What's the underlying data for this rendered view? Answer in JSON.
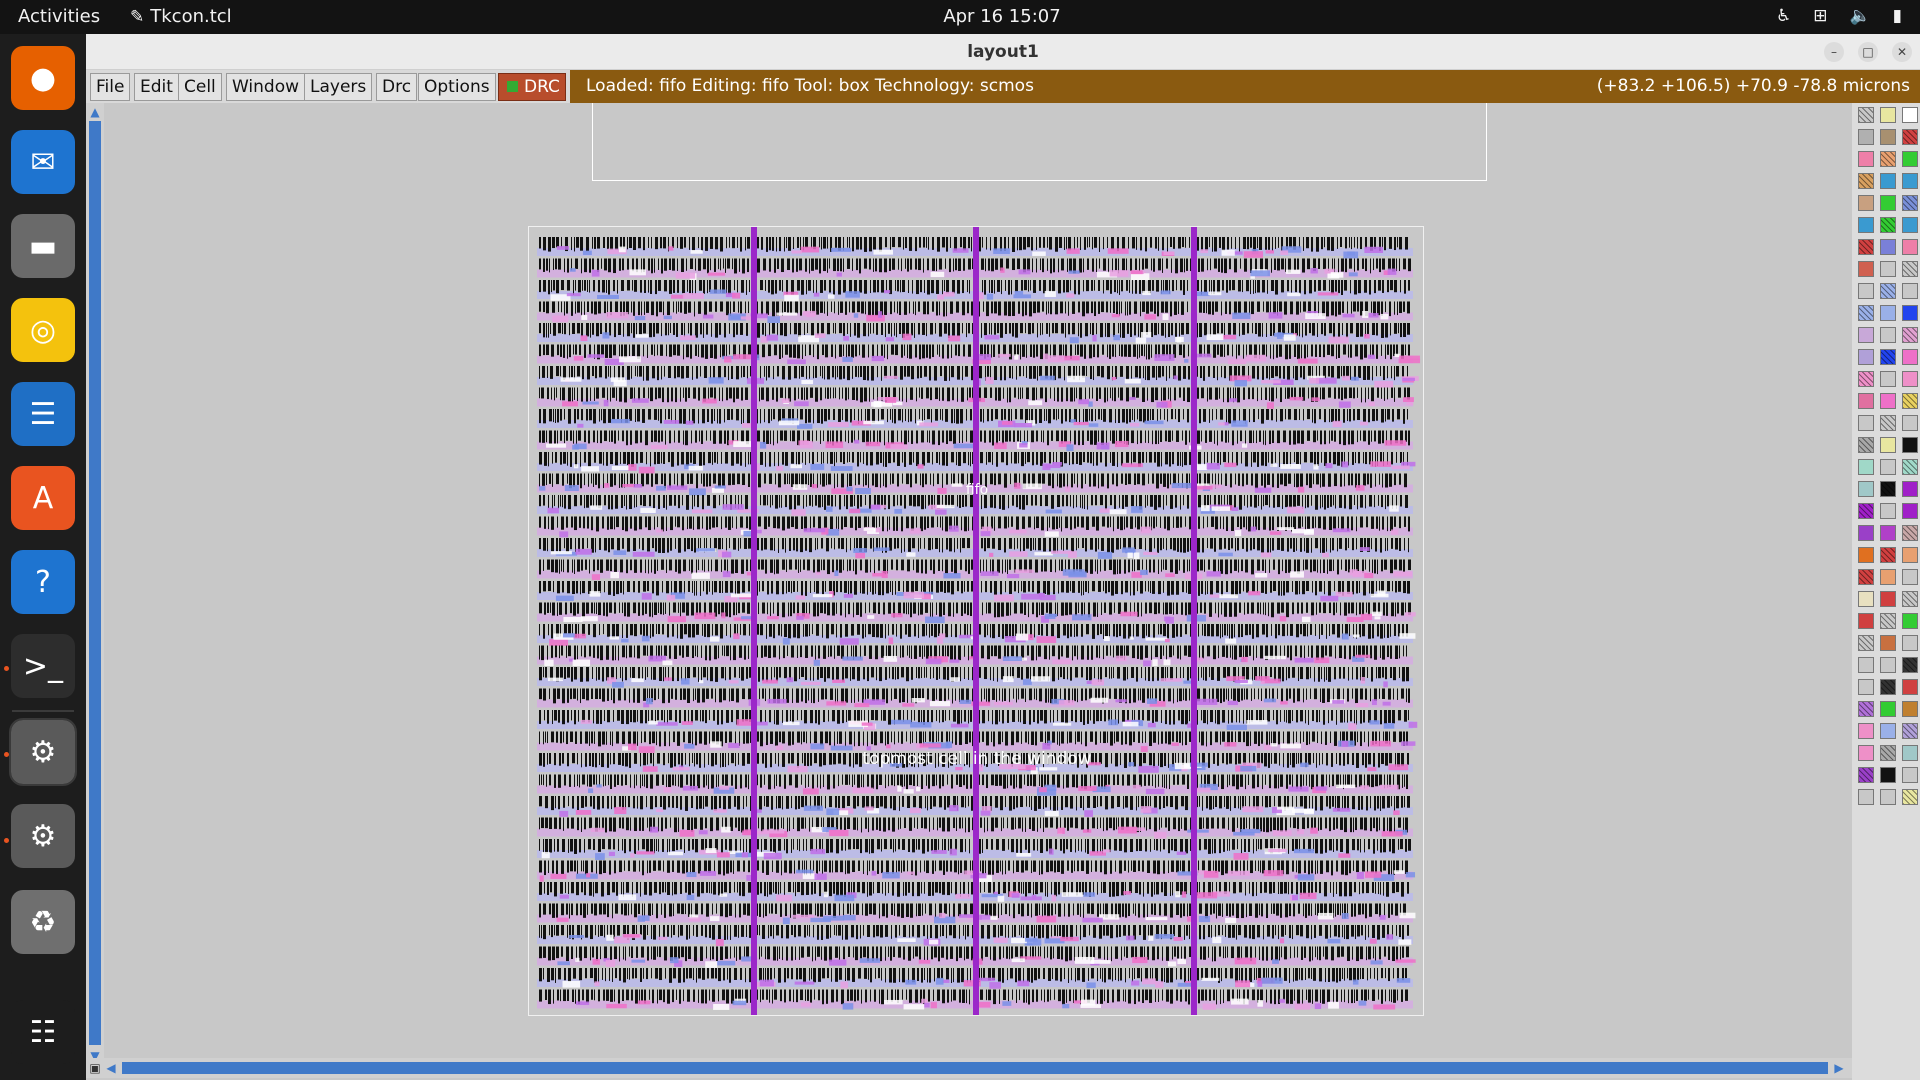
{
  "topbar": {
    "activities": "Activities",
    "app_name": "Tkcon.tcl",
    "clock": "Apr 16  15:07",
    "tray_icons": [
      "accessibility-icon",
      "network-icon",
      "volume-icon",
      "battery-icon"
    ]
  },
  "dock": {
    "apps": [
      {
        "name": "firefox-icon",
        "glyph": "●",
        "color": "#e66000"
      },
      {
        "name": "thunderbird-icon",
        "glyph": "✉",
        "color": "#1e74d0"
      },
      {
        "name": "files-icon",
        "glyph": "▬",
        "color": "#6a6a6a"
      },
      {
        "name": "rhythmbox-icon",
        "glyph": "◎",
        "color": "#f4c20d"
      },
      {
        "name": "writer-icon",
        "glyph": "☰",
        "color": "#1f6fc5"
      },
      {
        "name": "app-center-icon",
        "glyph": "A",
        "color": "#e95420"
      },
      {
        "name": "help-icon",
        "glyph": "?",
        "color": "#1e74d0"
      },
      {
        "name": "terminal-icon",
        "glyph": ">_",
        "color": "#2d2d2d"
      },
      {
        "name": "settings-icon",
        "glyph": "⚙",
        "color": "#5a5a5a"
      },
      {
        "name": "settings-icon-2",
        "glyph": "⚙",
        "color": "#5a5a5a"
      },
      {
        "name": "trash-icon",
        "glyph": "♻",
        "color": "#6f6f6f"
      },
      {
        "name": "show-apps-icon",
        "glyph": "☷",
        "color": "#1d1d1d"
      }
    ]
  },
  "window": {
    "title": "layout1",
    "menus": [
      "File",
      "Edit",
      "Cell",
      "Window",
      "Layers",
      "Drc",
      "Options"
    ],
    "drc_label": "DRC",
    "status_text": "Loaded: fifo Editing: fifo Tool: box  Technology: scmos",
    "coords_text": "(+83.2 +106.5) +70.9 -78.8 microns",
    "cell_label": "fifo",
    "cell_hint": "topmost cell in the window"
  },
  "colors": {
    "status_bg": "#8a5a10",
    "drc_bg": "#b84d2c",
    "scroll": "#3f79c8",
    "strap": "#9b27c9"
  }
}
